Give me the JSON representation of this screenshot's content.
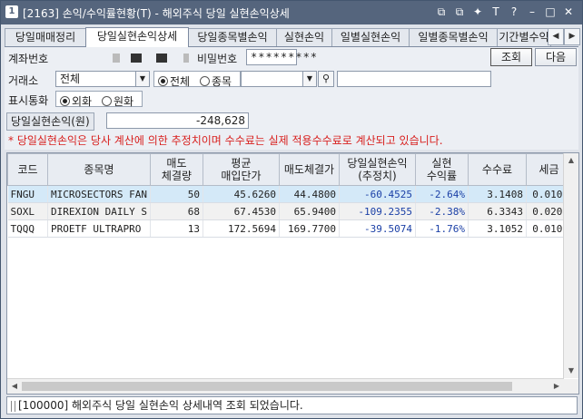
{
  "window": {
    "badge": "1",
    "title": "[2163] 손익/수익률현황(T) - 해외주식 당일 실현손익상세",
    "title_buttons": [
      "⧉",
      "⧉",
      "✦",
      "T",
      "?",
      "–",
      "□",
      "✕"
    ]
  },
  "tabs": [
    {
      "label": "당일매매정리",
      "active": false
    },
    {
      "label": "당일실현손익상세",
      "active": true
    },
    {
      "label": "당일종목별손익",
      "active": false
    },
    {
      "label": "실현손익",
      "active": false
    },
    {
      "label": "일별실현손익",
      "active": false
    },
    {
      "label": "일별종목별손익",
      "active": false
    },
    {
      "label": "기간별수익",
      "active": false
    }
  ],
  "form": {
    "account_label": "계좌번호",
    "password_label": "비밀번호",
    "password_value": "*********",
    "query_button": "조회",
    "next_button": "다음",
    "exchange_label": "거래소",
    "exchange_value": "전체",
    "scope_all": "전체",
    "scope_symbol": "종목",
    "currency_label": "표시통화",
    "currency_foreign": "외화",
    "currency_won": "원화",
    "today_pnl_label": "당일실현손익(원)",
    "today_pnl_value": "-248,628",
    "notice": "* 당일실현손익은 당사 계산에 의한 추정치이며 수수료는 실제 적용수수료로 계산되고 있습니다."
  },
  "table": {
    "headers": [
      "코드",
      "종목명",
      "매도\n체결량",
      "평균\n매입단가",
      "매도체결가",
      "당일실현손익\n(추정치)",
      "실현\n수익률",
      "수수료",
      "세금"
    ],
    "rows": [
      [
        "FNGU",
        "MICROSECTORS FAN",
        "50",
        "45.6260",
        "44.4800",
        "-60.4525",
        "-2.64%",
        "3.1408",
        "0.0100"
      ],
      [
        "SOXL",
        "DIREXION DAILY S",
        "68",
        "67.4530",
        "65.9400",
        "-109.2355",
        "-2.38%",
        "6.3343",
        "0.0200"
      ],
      [
        "TQQQ",
        "PROETF ULTRAPRO",
        "13",
        "172.5694",
        "169.7700",
        "-39.5074",
        "-1.76%",
        "3.1052",
        "0.0100"
      ]
    ]
  },
  "status": {
    "message": "[100000] 해외주식 당일 실현손익 상세내역 조회 되었습니다."
  }
}
